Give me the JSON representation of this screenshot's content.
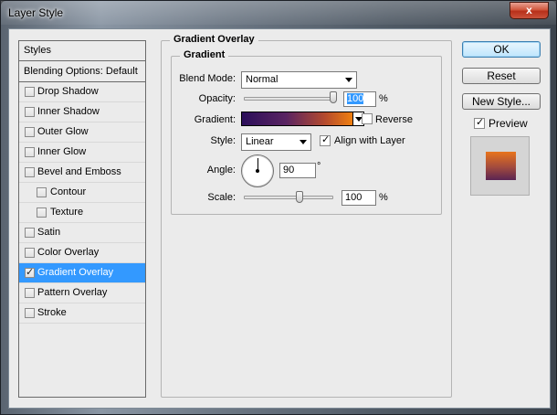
{
  "window": {
    "title": "Layer Style",
    "close_glyph": "x"
  },
  "styles_panel": {
    "header": "Styles",
    "blending": "Blending Options: Default",
    "items": [
      {
        "label": "Drop Shadow",
        "checked": false,
        "indent": false
      },
      {
        "label": "Inner Shadow",
        "checked": false,
        "indent": false
      },
      {
        "label": "Outer Glow",
        "checked": false,
        "indent": false
      },
      {
        "label": "Inner Glow",
        "checked": false,
        "indent": false
      },
      {
        "label": "Bevel and Emboss",
        "checked": false,
        "indent": false
      },
      {
        "label": "Contour",
        "checked": false,
        "indent": true
      },
      {
        "label": "Texture",
        "checked": false,
        "indent": true
      },
      {
        "label": "Satin",
        "checked": false,
        "indent": false
      },
      {
        "label": "Color Overlay",
        "checked": false,
        "indent": false
      },
      {
        "label": "Gradient Overlay",
        "checked": true,
        "indent": false,
        "selected": true
      },
      {
        "label": "Pattern Overlay",
        "checked": false,
        "indent": false
      },
      {
        "label": "Stroke",
        "checked": false,
        "indent": false
      }
    ]
  },
  "buttons": {
    "ok": "OK",
    "reset": "Reset",
    "new_style": "New Style...",
    "preview": "Preview"
  },
  "group": {
    "outer_title": "Gradient Overlay",
    "inner_title": "Gradient"
  },
  "fields": {
    "blend_mode_label": "Blend Mode:",
    "blend_mode_value": "Normal",
    "opacity_label": "Opacity:",
    "opacity_value": "100",
    "opacity_unit": "%",
    "gradient_label": "Gradient:",
    "reverse_label": "Reverse",
    "style_label": "Style:",
    "style_value": "Linear",
    "align_label": "Align with Layer",
    "angle_label": "Angle:",
    "angle_value": "90",
    "angle_unit": "°",
    "scale_label": "Scale:",
    "scale_value": "100",
    "scale_unit": "%"
  },
  "colors": {
    "gradient_start": "#2b0e5a",
    "gradient_end": "#f08010",
    "selection": "#3399ff"
  }
}
